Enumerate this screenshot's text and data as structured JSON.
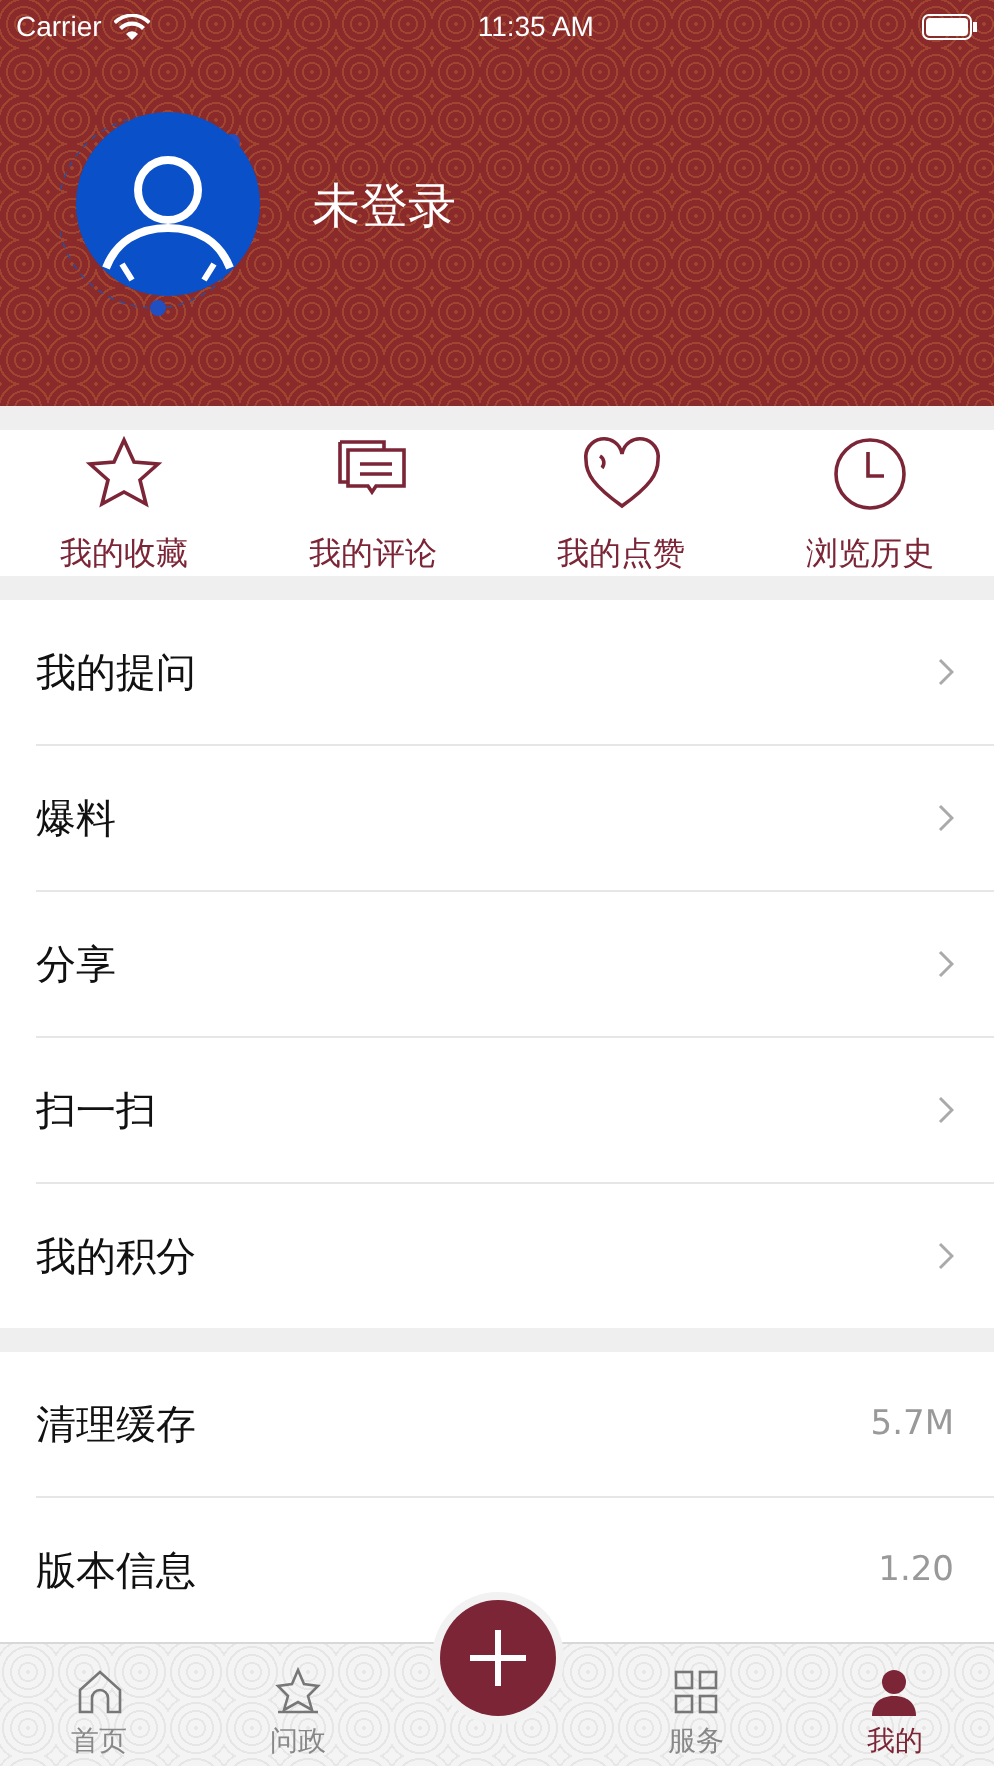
{
  "status_bar": {
    "carrier": "Carrier",
    "time": "11:35 AM"
  },
  "profile": {
    "name": "未登录"
  },
  "shortcuts": [
    {
      "label": "我的收藏",
      "kind": "star"
    },
    {
      "label": "我的评论",
      "kind": "comment"
    },
    {
      "label": "我的点赞",
      "kind": "heart"
    },
    {
      "label": "浏览历史",
      "kind": "clock"
    }
  ],
  "menu": [
    {
      "label": "我的提问"
    },
    {
      "label": "爆料"
    },
    {
      "label": "分享"
    },
    {
      "label": "扫一扫"
    },
    {
      "label": "我的积分"
    }
  ],
  "settings": [
    {
      "label": "清理缓存",
      "value": "5.7M"
    },
    {
      "label": "版本信息",
      "value": "1.20"
    }
  ],
  "tabs": [
    {
      "label": "首页",
      "kind": "home",
      "selected": false
    },
    {
      "label": "问政",
      "kind": "star",
      "selected": false
    },
    {
      "label": "服务",
      "kind": "grid",
      "selected": false
    },
    {
      "label": "我的",
      "kind": "person",
      "selected": true
    }
  ]
}
